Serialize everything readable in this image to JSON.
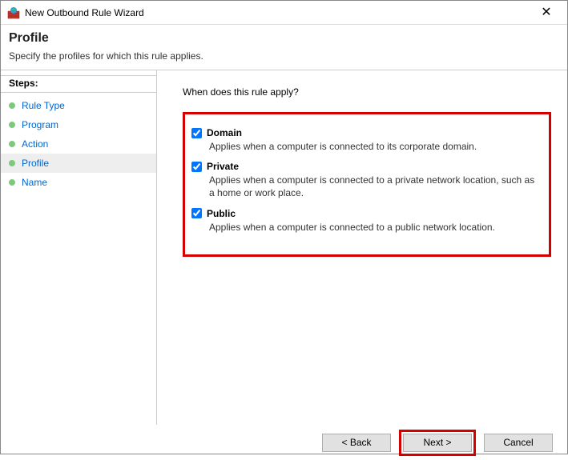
{
  "titlebar": {
    "title": "New Outbound Rule Wizard"
  },
  "header": {
    "big": "Profile",
    "desc": "Specify the profiles for which this rule applies."
  },
  "steps": {
    "heading": "Steps:",
    "items": [
      {
        "label": "Rule Type",
        "active": false
      },
      {
        "label": "Program",
        "active": false
      },
      {
        "label": "Action",
        "active": false
      },
      {
        "label": "Profile",
        "active": true
      },
      {
        "label": "Name",
        "active": false
      }
    ]
  },
  "content": {
    "question": "When does this rule apply?",
    "profiles": [
      {
        "name": "Domain",
        "desc": "Applies when a computer is connected to its corporate domain.",
        "checked": true
      },
      {
        "name": "Private",
        "desc": "Applies when a computer is connected to a private network location, such as a home or work place.",
        "checked": true
      },
      {
        "name": "Public",
        "desc": "Applies when a computer is connected to a public network location.",
        "checked": true
      }
    ]
  },
  "footer": {
    "back": "< Back",
    "next": "Next >",
    "cancel": "Cancel"
  }
}
